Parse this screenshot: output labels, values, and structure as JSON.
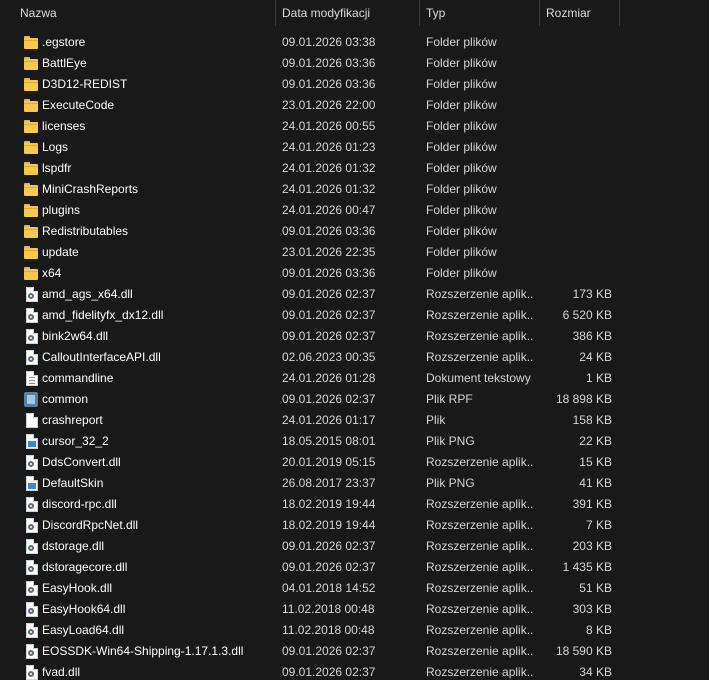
{
  "columns": {
    "name": "Nazwa",
    "date": "Data modyfikacji",
    "type": "Typ",
    "size": "Rozmiar"
  },
  "sort_arrow": "^",
  "files": [
    {
      "name": ".egstore",
      "date": "09.01.2026 03:38",
      "type": "Folder plików",
      "size": "",
      "icon": "folder-icon"
    },
    {
      "name": "BattlEye",
      "date": "09.01.2026 03:36",
      "type": "Folder plików",
      "size": "",
      "icon": "folder-icon"
    },
    {
      "name": "D3D12-REDIST",
      "date": "09.01.2026 03:36",
      "type": "Folder plików",
      "size": "",
      "icon": "folder-icon"
    },
    {
      "name": "ExecuteCode",
      "date": "23.01.2026 22:00",
      "type": "Folder plików",
      "size": "",
      "icon": "folder-icon"
    },
    {
      "name": "licenses",
      "date": "24.01.2026 00:55",
      "type": "Folder plików",
      "size": "",
      "icon": "folder-icon"
    },
    {
      "name": "Logs",
      "date": "24.01.2026 01:23",
      "type": "Folder plików",
      "size": "",
      "icon": "folder-icon"
    },
    {
      "name": "lspdfr",
      "date": "24.01.2026 01:32",
      "type": "Folder plików",
      "size": "",
      "icon": "folder-icon"
    },
    {
      "name": "MiniCrashReports",
      "date": "24.01.2026 01:32",
      "type": "Folder plików",
      "size": "",
      "icon": "folder-icon"
    },
    {
      "name": "plugins",
      "date": "24.01.2026 00:47",
      "type": "Folder plików",
      "size": "",
      "icon": "folder-icon"
    },
    {
      "name": "Redistributables",
      "date": "09.01.2026 03:36",
      "type": "Folder plików",
      "size": "",
      "icon": "folder-icon"
    },
    {
      "name": "update",
      "date": "23.01.2026 22:35",
      "type": "Folder plików",
      "size": "",
      "icon": "folder-icon"
    },
    {
      "name": "x64",
      "date": "09.01.2026 03:36",
      "type": "Folder plików",
      "size": "",
      "icon": "folder-icon"
    },
    {
      "name": "amd_ags_x64.dll",
      "date": "09.01.2026 02:37",
      "type": "Rozszerzenie aplik...",
      "size": "173 KB",
      "icon": "dll-file-icon"
    },
    {
      "name": "amd_fidelityfx_dx12.dll",
      "date": "09.01.2026 02:37",
      "type": "Rozszerzenie aplik...",
      "size": "6 520 KB",
      "icon": "dll-file-icon"
    },
    {
      "name": "bink2w64.dll",
      "date": "09.01.2026 02:37",
      "type": "Rozszerzenie aplik...",
      "size": "386 KB",
      "icon": "dll-file-icon"
    },
    {
      "name": "CalloutInterfaceAPI.dll",
      "date": "02.06.2023 00:35",
      "type": "Rozszerzenie aplik...",
      "size": "24 KB",
      "icon": "dll-file-icon"
    },
    {
      "name": "commandline",
      "date": "24.01.2026 01:28",
      "type": "Dokument tekstowy",
      "size": "1 KB",
      "icon": "text-file-icon"
    },
    {
      "name": "common",
      "date": "09.01.2026 02:37",
      "type": "Plik RPF",
      "size": "18 898 KB",
      "icon": "rpf-file-icon"
    },
    {
      "name": "crashreport",
      "date": "24.01.2026 01:17",
      "type": "Plik",
      "size": "158 KB",
      "icon": "blank-file-icon"
    },
    {
      "name": "cursor_32_2",
      "date": "18.05.2015 08:01",
      "type": "Plik PNG",
      "size": "22 KB",
      "icon": "png-file-icon"
    },
    {
      "name": "DdsConvert.dll",
      "date": "20.01.2019 05:15",
      "type": "Rozszerzenie aplik...",
      "size": "15 KB",
      "icon": "dll-file-icon"
    },
    {
      "name": "DefaultSkin",
      "date": "26.08.2017 23:37",
      "type": "Plik PNG",
      "size": "41 KB",
      "icon": "png-file-icon"
    },
    {
      "name": "discord-rpc.dll",
      "date": "18.02.2019 19:44",
      "type": "Rozszerzenie aplik...",
      "size": "391 KB",
      "icon": "dll-file-icon"
    },
    {
      "name": "DiscordRpcNet.dll",
      "date": "18.02.2019 19:44",
      "type": "Rozszerzenie aplik...",
      "size": "7 KB",
      "icon": "dll-file-icon"
    },
    {
      "name": "dstorage.dll",
      "date": "09.01.2026 02:37",
      "type": "Rozszerzenie aplik...",
      "size": "203 KB",
      "icon": "dll-file-icon"
    },
    {
      "name": "dstoragecore.dll",
      "date": "09.01.2026 02:37",
      "type": "Rozszerzenie aplik...",
      "size": "1 435 KB",
      "icon": "dll-file-icon"
    },
    {
      "name": "EasyHook.dll",
      "date": "04.01.2018 14:52",
      "type": "Rozszerzenie aplik...",
      "size": "51 KB",
      "icon": "dll-file-icon"
    },
    {
      "name": "EasyHook64.dll",
      "date": "11.02.2018 00:48",
      "type": "Rozszerzenie aplik...",
      "size": "303 KB",
      "icon": "dll-file-icon"
    },
    {
      "name": "EasyLoad64.dll",
      "date": "11.02.2018 00:48",
      "type": "Rozszerzenie aplik...",
      "size": "8 KB",
      "icon": "dll-file-icon"
    },
    {
      "name": "EOSSDK-Win64-Shipping-1.17.1.3.dll",
      "date": "09.01.2026 02:37",
      "type": "Rozszerzenie aplik...",
      "size": "18 590 KB",
      "icon": "dll-file-icon"
    },
    {
      "name": "fvad.dll",
      "date": "09.01.2026 02:37",
      "type": "Rozszerzenie aplik...",
      "size": "34 KB",
      "icon": "dll-file-icon"
    }
  ]
}
